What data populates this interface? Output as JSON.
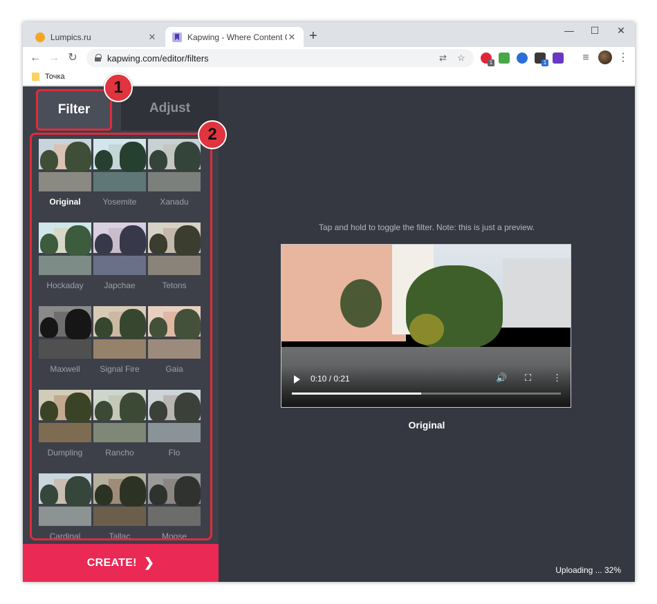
{
  "browser": {
    "tabs": [
      {
        "title": "Lumpics.ru",
        "close": "✕"
      },
      {
        "title": "Kapwing - Where Content Creati",
        "close": "✕"
      }
    ],
    "new_tab": "+",
    "window_controls": {
      "minimize": "—",
      "maximize": "☐",
      "close": "✕"
    },
    "url": "kapwing.com/editor/filters",
    "bookmark": "Точка",
    "extensions": [
      {
        "name": "opera-extension-icon",
        "color": "#e0243a",
        "badge": "1"
      },
      {
        "name": "music-extension-icon",
        "color": "#4aa64a",
        "badge": ""
      },
      {
        "name": "vpn-extension-icon",
        "color": "#2b6fd6",
        "badge": ""
      },
      {
        "name": "box-extension-icon",
        "color": "#3a3a3a",
        "badge": "1"
      },
      {
        "name": "ad-extension-icon",
        "color": "#6a38c2",
        "badge": ""
      }
    ]
  },
  "sidebar": {
    "tab_filter": "Filter",
    "tab_adjust": "Adjust",
    "callout_1": "1",
    "callout_2": "2",
    "filters": [
      {
        "label": "Original",
        "selected": true,
        "sky": "#c8d3dc",
        "wall": "#d9c2b3",
        "tree": "#3f4e37",
        "ground": "#8a8a83"
      },
      {
        "label": "Yosemite",
        "selected": false,
        "sky": "#d3e6ec",
        "wall": "#c5d6d6",
        "tree": "#25402f",
        "ground": "#5f7877"
      },
      {
        "label": "Xanadu",
        "selected": false,
        "sky": "#c9d2d2",
        "wall": "#c4c6c0",
        "tree": "#34443a",
        "ground": "#7b807c"
      },
      {
        "label": "Hockaday",
        "selected": false,
        "sky": "#cfe6ea",
        "wall": "#d8d8c8",
        "tree": "#3d5b3d",
        "ground": "#7d8c86"
      },
      {
        "label": "Japchae",
        "selected": false,
        "sky": "#d9cfe0",
        "wall": "#c9bccb",
        "tree": "#37384a",
        "ground": "#6a7088"
      },
      {
        "label": "Tetons",
        "selected": false,
        "sky": "#d8d1c6",
        "wall": "#c2b8ab",
        "tree": "#3b3d2f",
        "ground": "#8a837a"
      },
      {
        "label": "Maxwell",
        "selected": false,
        "sky": "#8a8a8a",
        "wall": "#6e6e6e",
        "tree": "#161616",
        "ground": "#505050"
      },
      {
        "label": "Signal Fire",
        "selected": false,
        "sky": "#d8cbb6",
        "wall": "#cdb9a2",
        "tree": "#37472f",
        "ground": "#96826a"
      },
      {
        "label": "Gaia",
        "selected": false,
        "sky": "#e7d0bf",
        "wall": "#e0b7a3",
        "tree": "#44513a",
        "ground": "#9c8b7c"
      },
      {
        "label": "Dumpling",
        "selected": false,
        "sky": "#d1ccb8",
        "wall": "#c2a98f",
        "tree": "#3b4327",
        "ground": "#7d6c52"
      },
      {
        "label": "Rancho",
        "selected": false,
        "sky": "#cdd6cc",
        "wall": "#c4c8b6",
        "tree": "#3c4a35",
        "ground": "#7f8776"
      },
      {
        "label": "Flo",
        "selected": false,
        "sky": "#cdd5d9",
        "wall": "#b9b6b2",
        "tree": "#3b4138",
        "ground": "#8a9498"
      },
      {
        "label": "Cardinal",
        "selected": false,
        "sky": "#c9d6dc",
        "wall": "#cabdb2",
        "tree": "#36463b",
        "ground": "#8c9493"
      },
      {
        "label": "Tallac",
        "selected": false,
        "sky": "#b4b09d",
        "wall": "#9e8d76",
        "tree": "#2d3324",
        "ground": "#6b5e4b"
      },
      {
        "label": "Moose",
        "selected": false,
        "sky": "#9a9a9a",
        "wall": "#8b8681",
        "tree": "#2f322e",
        "ground": "#6c6c6a"
      }
    ],
    "create_label": "CREATE!",
    "create_chevron": "❯"
  },
  "main": {
    "hint": "Tap and hold to toggle the filter. Note: this is just a preview.",
    "video_time": "0:10 / 0:21",
    "video_progress": 0.48,
    "video_label": "Original",
    "status": "Uploading ... 32%"
  }
}
